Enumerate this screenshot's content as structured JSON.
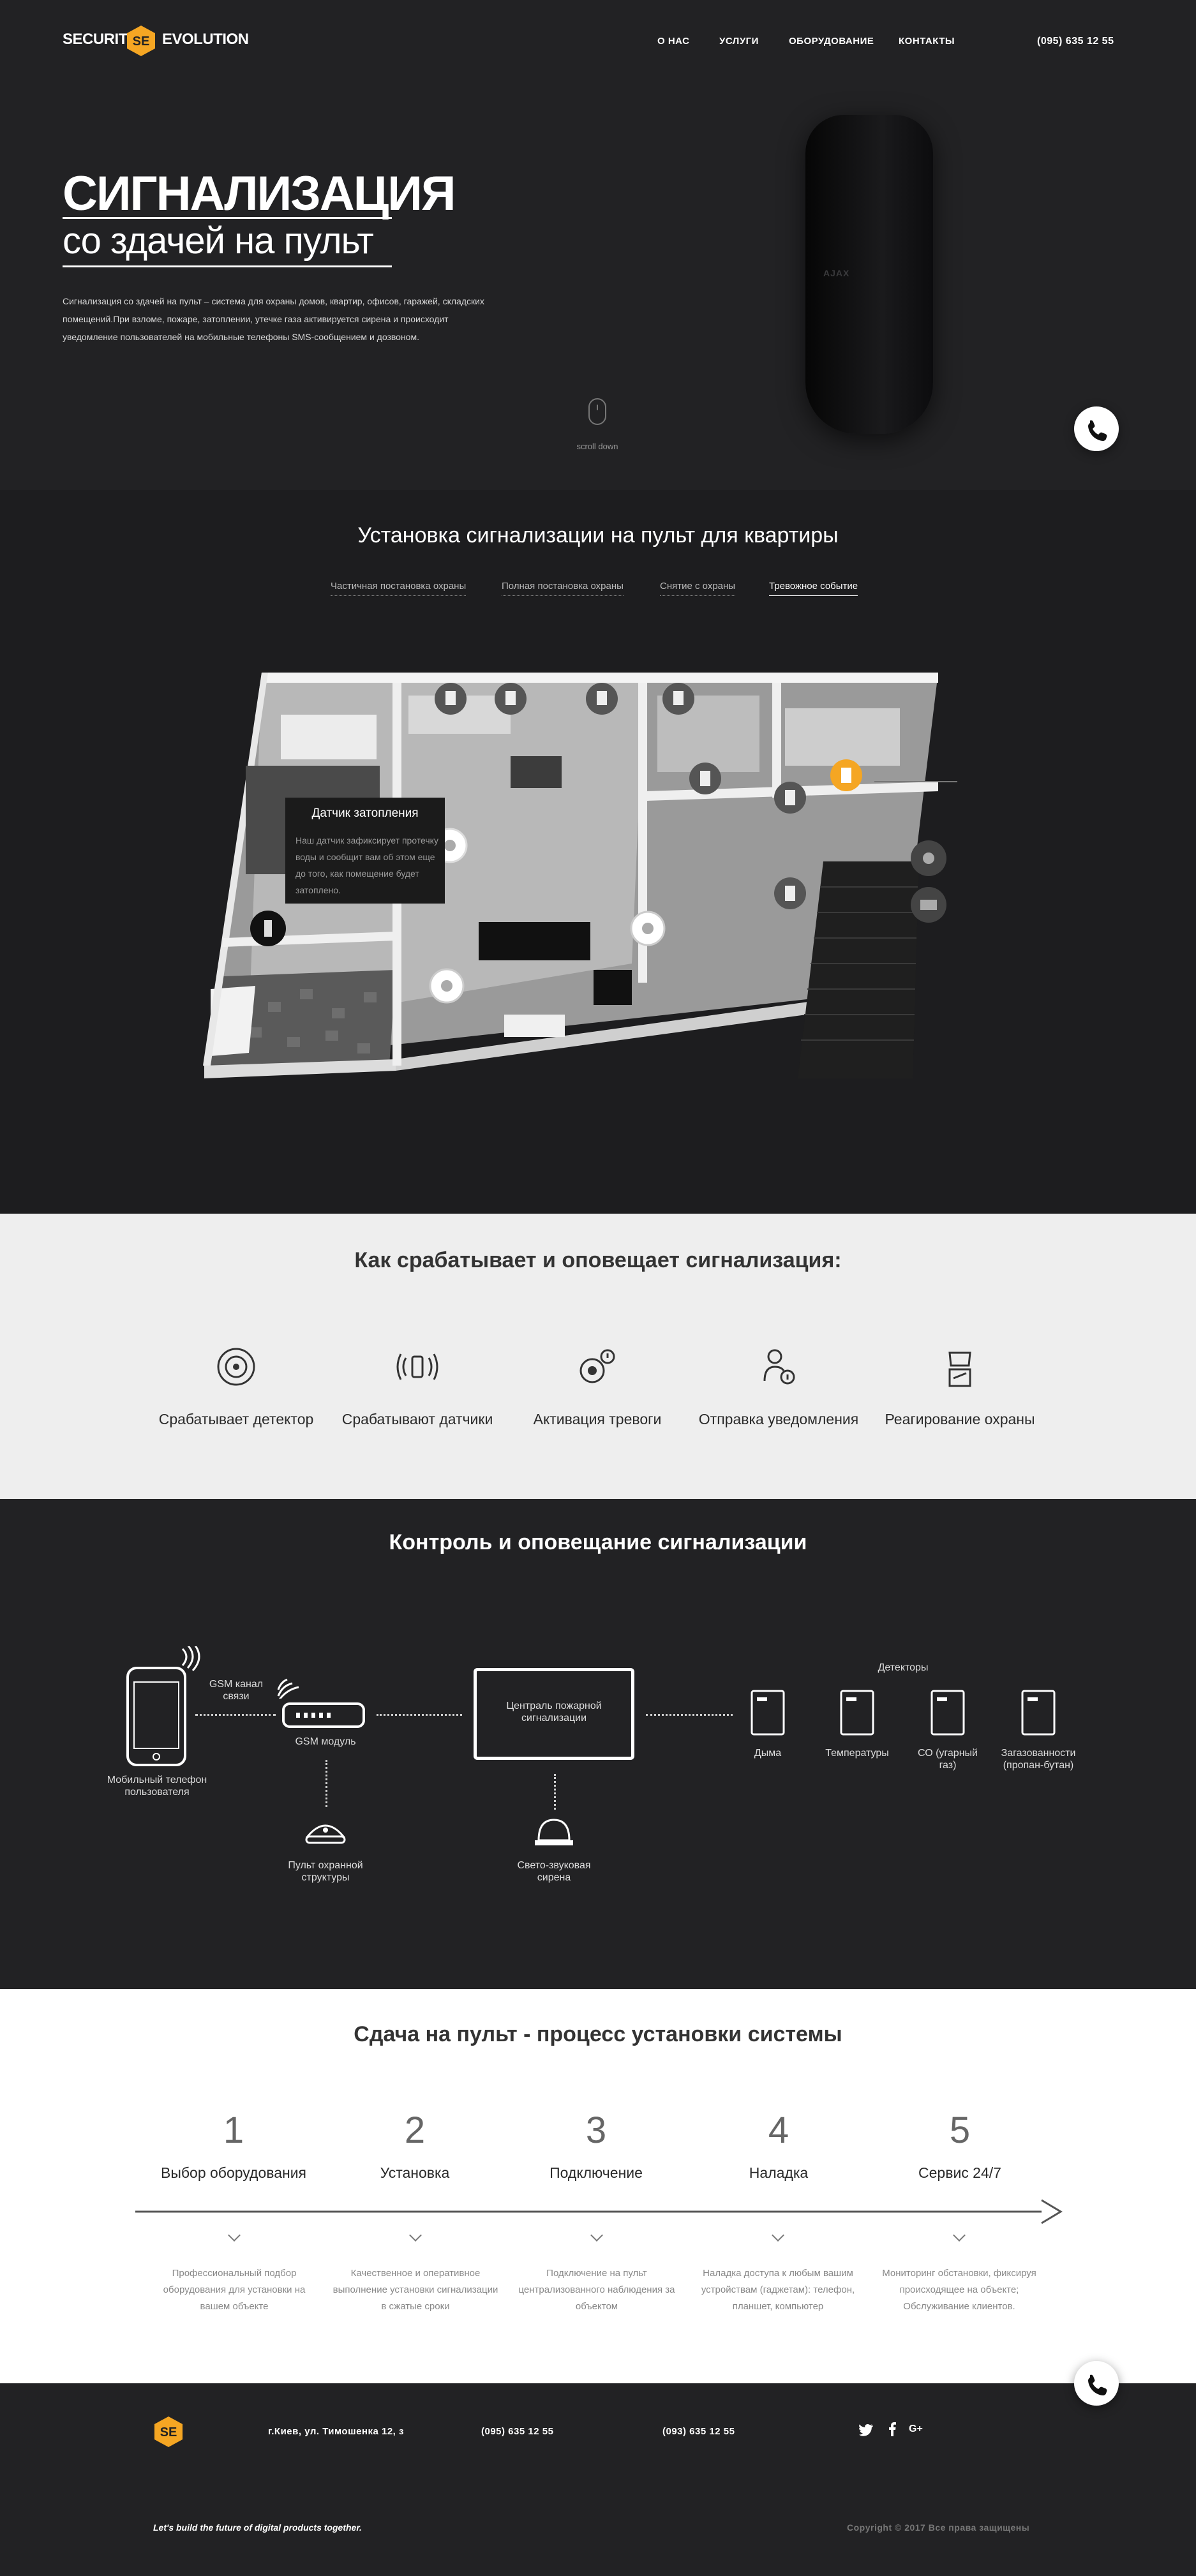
{
  "brand": {
    "left": "SECURITY",
    "right": "EVOLUTION",
    "accent": "#f5a623"
  },
  "nav": {
    "items": [
      "О НАС",
      "УСЛУГИ",
      "ОБОРУДОВАНИЕ",
      "КОНТАКТЫ"
    ],
    "phone": "(095) 635 12 55"
  },
  "hero": {
    "title": "СИГНАЛИЗАЦИЯ",
    "subtitle": "со здачей на пульт",
    "description": "Сигнализация со здачей на пульт  – система для охраны домов, квартир, офисов, гаражей, складских помещений.При взломе, пожаре, затоплении, утечке газа активируется сирена и происходит уведомление пользователей на мобильные телефоны SMS-сообщением и дозвоном.",
    "scroll": "scroll down",
    "device_logo": "AJAX"
  },
  "install": {
    "title": "Установка сигнализации на пульт для квартиры",
    "tabs": [
      "Частичная постановка охраны",
      "Полная постановка охраны",
      "Снятие с охраны",
      "Тревожное событие"
    ],
    "active_tab": "Тревожное событие",
    "tooltip": {
      "title": "Датчик затопления",
      "body": "Наш датчик зафиксирует протечку воды и сообщит вам об этом еще до того, как помещение будет затоплено."
    }
  },
  "how": {
    "title": "Как срабатывает и оповещает сигнализация:",
    "steps": [
      {
        "icon": "detector-icon",
        "label": "Срабатывает детектор"
      },
      {
        "icon": "sensors-icon",
        "label": "Срабатывают датчики"
      },
      {
        "icon": "alarm-activation-icon",
        "label": "Активация тревоги"
      },
      {
        "icon": "notification-icon",
        "label": "Отправка уведомления"
      },
      {
        "icon": "security-response-icon",
        "label": "Реагирование охраны"
      }
    ]
  },
  "control": {
    "title": "Контроль и оповещание сигнализации",
    "phone_label": "Мобильный телефон пользователя",
    "gsm_channel": "GSM канал связи",
    "gsm_module": "GSM модуль",
    "central": "Централь пожарной сигнализации",
    "detectors_title": "Детекторы",
    "detectors": [
      "Дыма",
      "Температуры",
      "СО (угарный газ)",
      "Загазованности (пропан-бутан)"
    ],
    "guard": "Пульт охранной структуры",
    "siren": "Свето-звуковая сирена"
  },
  "process": {
    "title": "Сдача на пульт - процесс установки системы",
    "steps": [
      {
        "num": "1",
        "name": "Выбор оборудования",
        "desc": "Профессиональный подбор оборудования для установки на вашем объекте"
      },
      {
        "num": "2",
        "name": "Установка",
        "desc": "Качественное и оперативное выполнение установки сигнализации в сжатые сроки"
      },
      {
        "num": "3",
        "name": "Подключение",
        "desc": "Подключение на пульт централизованного наблюдения за объектом"
      },
      {
        "num": "4",
        "name": "Наладка",
        "desc": "Наладка доступа к любым вашим устройствам (гаджетам): телефон, планшет, компьютер"
      },
      {
        "num": "5",
        "name": "Сервис 24/7",
        "desc": "Мониторинг обстановки, фиксируя происходящее на объекте; Обслуживание клиентов."
      }
    ]
  },
  "footer": {
    "address": "г.Киев, ул. Тимошенка 12, з",
    "phone1": "(095) 635 12 55",
    "phone2": "(093) 635 12 55",
    "social": [
      "twitter-icon",
      "facebook-icon",
      "google-plus-icon"
    ],
    "tagline": "Let's build the future of digital products together.",
    "copyright": "Copyright © 2017 Все права защищены"
  }
}
